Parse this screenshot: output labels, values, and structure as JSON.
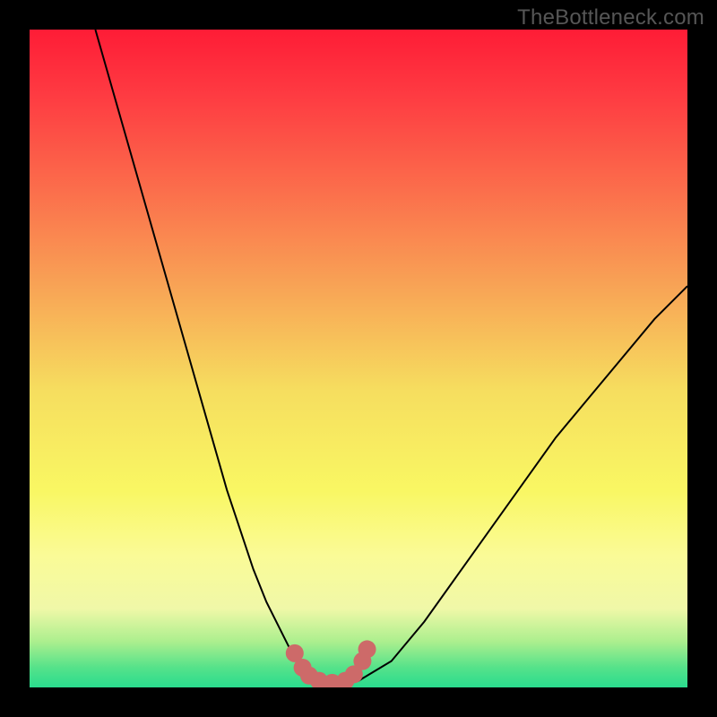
{
  "watermark": {
    "text": "TheBottleneck.com"
  },
  "chart_data": {
    "type": "line",
    "title": "",
    "xlabel": "",
    "ylabel": "",
    "xlim": [
      0,
      100
    ],
    "ylim": [
      0,
      100
    ],
    "grid": false,
    "legend": false,
    "background_gradient": {
      "stops": [
        {
          "offset": 0.0,
          "color": "#fe1c36"
        },
        {
          "offset": 0.1,
          "color": "#fe3b42"
        },
        {
          "offset": 0.25,
          "color": "#fb704c"
        },
        {
          "offset": 0.4,
          "color": "#f8a756"
        },
        {
          "offset": 0.55,
          "color": "#f6de5f"
        },
        {
          "offset": 0.7,
          "color": "#f9f763"
        },
        {
          "offset": 0.8,
          "color": "#fafb97"
        },
        {
          "offset": 0.88,
          "color": "#f0f8a8"
        },
        {
          "offset": 0.93,
          "color": "#acef8e"
        },
        {
          "offset": 0.97,
          "color": "#55e28a"
        },
        {
          "offset": 1.0,
          "color": "#2adc8e"
        }
      ]
    },
    "series": [
      {
        "name": "bottleneck-curve",
        "stroke": "#000000",
        "stroke_width": 2,
        "x": [
          10,
          12,
          14,
          16,
          18,
          20,
          22,
          24,
          26,
          28,
          30,
          32,
          34,
          36,
          38,
          40,
          41,
          42,
          43,
          44,
          45,
          46,
          47,
          48,
          50,
          55,
          60,
          65,
          70,
          75,
          80,
          85,
          90,
          95,
          100
        ],
        "y": [
          100,
          93,
          86,
          79,
          72,
          65,
          58,
          51,
          44,
          37,
          30,
          24,
          18,
          13,
          9,
          5,
          3.5,
          2.4,
          1.6,
          1.0,
          0.6,
          0.5,
          0.5,
          0.6,
          1.0,
          4,
          10,
          17,
          24,
          31,
          38,
          44,
          50,
          56,
          61
        ]
      }
    ],
    "markers": {
      "name": "curve-bottom-markers",
      "fill": "#cd6a69",
      "radius_px": 10,
      "points": [
        {
          "x": 40.3,
          "y": 5.2
        },
        {
          "x": 41.5,
          "y": 3.0
        },
        {
          "x": 42.5,
          "y": 1.8
        },
        {
          "x": 44.0,
          "y": 1.0
        },
        {
          "x": 46.0,
          "y": 0.7
        },
        {
          "x": 48.0,
          "y": 1.0
        },
        {
          "x": 49.3,
          "y": 2.0
        },
        {
          "x": 50.6,
          "y": 4.0
        },
        {
          "x": 51.3,
          "y": 5.8
        }
      ]
    },
    "bottom_segment": {
      "stroke": "#cd6a69",
      "stroke_width": 13,
      "x": [
        42.2,
        44.0,
        46.0,
        48.0,
        49.5
      ],
      "y": [
        1.9,
        0.9,
        0.7,
        0.9,
        1.8
      ]
    }
  }
}
